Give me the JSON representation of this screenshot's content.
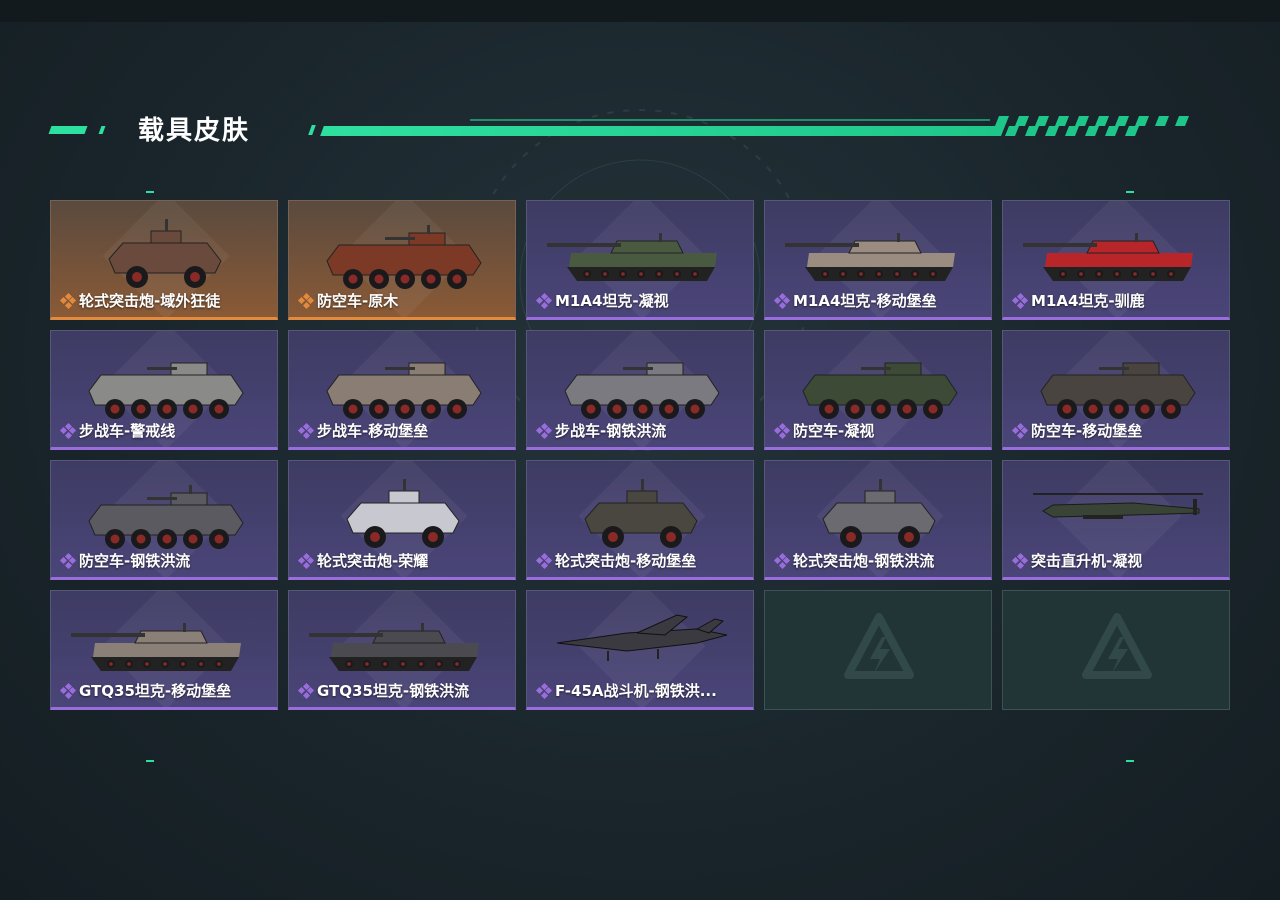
{
  "section": {
    "title": "载具皮肤"
  },
  "colors": {
    "accent": "#2ee0a0",
    "legendary": "#e28a3e",
    "epic": "#9a6ddc"
  },
  "skins": [
    {
      "name": "轮式突击炮-域外狂徒",
      "rarity": "orange",
      "kind": "wheeled-4",
      "color": "#6a4a3c"
    },
    {
      "name": "防空车-原木",
      "rarity": "orange",
      "kind": "apc-8-turret",
      "color": "#7c3a26"
    },
    {
      "name": "M1A4坦克-凝视",
      "rarity": "purple",
      "kind": "tank",
      "color": "#4a5a40"
    },
    {
      "name": "M1A4坦克-移动堡垒",
      "rarity": "purple",
      "kind": "tank",
      "color": "#9a8c80"
    },
    {
      "name": "M1A4坦克-驯鹿",
      "rarity": "purple",
      "kind": "tank",
      "color": "#b8262a"
    },
    {
      "name": "步战车-警戒线",
      "rarity": "purple",
      "kind": "apc-8",
      "color": "#8a8a88"
    },
    {
      "name": "步战车-移动堡垒",
      "rarity": "purple",
      "kind": "apc-8",
      "color": "#8a7e74"
    },
    {
      "name": "步战车-钢铁洪流",
      "rarity": "purple",
      "kind": "apc-8",
      "color": "#7a7a80"
    },
    {
      "name": "防空车-凝视",
      "rarity": "purple",
      "kind": "apc-8",
      "color": "#3c4a36"
    },
    {
      "name": "防空车-移动堡垒",
      "rarity": "purple",
      "kind": "apc-8",
      "color": "#4a4440"
    },
    {
      "name": "防空车-钢铁洪流",
      "rarity": "purple",
      "kind": "apc-8-turret",
      "color": "#5a5a60"
    },
    {
      "name": "轮式突击炮-荣耀",
      "rarity": "purple",
      "kind": "wheeled-4",
      "color": "#c8c8d0"
    },
    {
      "name": "轮式突击炮-移动堡垒",
      "rarity": "purple",
      "kind": "wheeled-4",
      "color": "#4a4640"
    },
    {
      "name": "轮式突击炮-钢铁洪流",
      "rarity": "purple",
      "kind": "wheeled-4",
      "color": "#6a6a70"
    },
    {
      "name": "突击直升机-凝视",
      "rarity": "purple",
      "kind": "heli",
      "color": "#3a4436"
    },
    {
      "name": "GTQ35坦克-移动堡垒",
      "rarity": "purple",
      "kind": "tank",
      "color": "#8a8078"
    },
    {
      "name": "GTQ35坦克-钢铁洪流",
      "rarity": "purple",
      "kind": "tank",
      "color": "#4a4a50"
    },
    {
      "name": "F-45A战斗机-钢铁洪...",
      "rarity": "purple",
      "kind": "jet",
      "color": "#3a3a40"
    }
  ],
  "empty_slots": 2
}
